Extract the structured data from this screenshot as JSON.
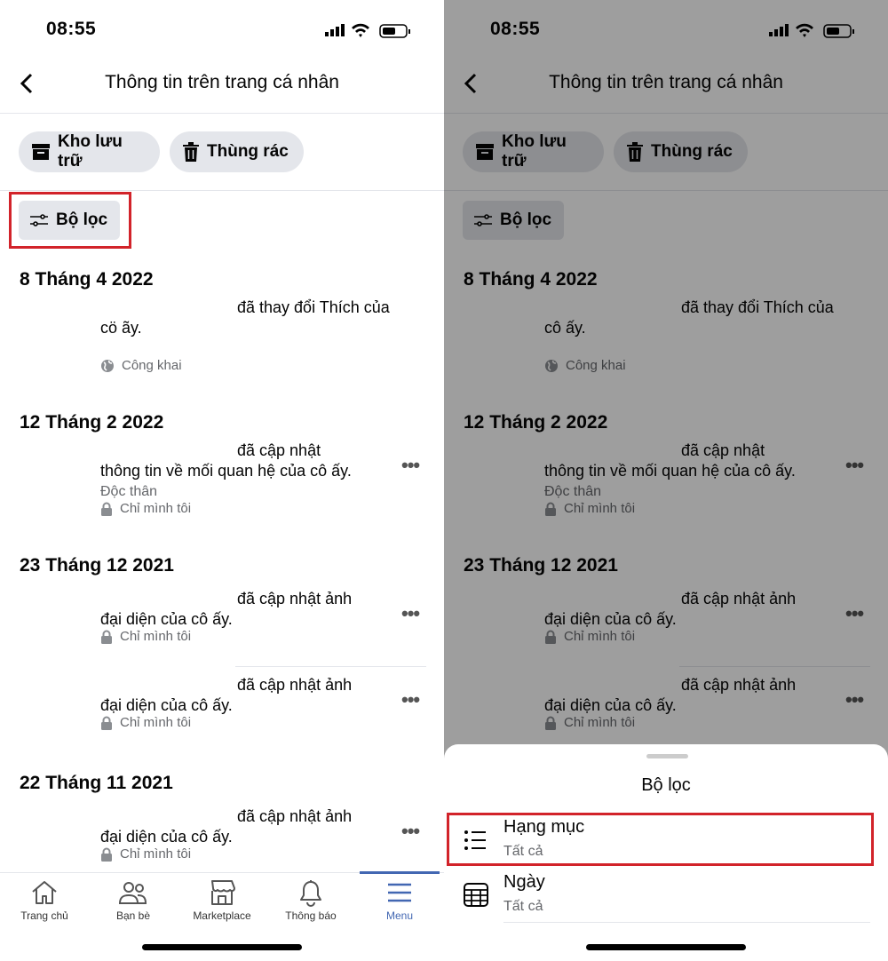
{
  "status_bar": {
    "time": "08:55"
  },
  "header": {
    "title": "Thông tin trên trang cá nhân",
    "back_icon": "chevron-left-icon"
  },
  "toolbar": {
    "archive_label": "Kho lưu trữ",
    "trash_label": "Thùng rác",
    "filter_label": "Bộ lọc"
  },
  "panels": [
    {
      "groups": [
        {
          "date": "8 Tháng 4 2022",
          "entries": [
            {
              "line1": "đã thay đổi Thích của",
              "line2": "cö ãy.",
              "privacy": "Công khai",
              "privacy_icon": "globe-icon",
              "more": false
            }
          ]
        },
        {
          "date": "12 Tháng 2 2022",
          "entries": [
            {
              "line1": "đã cập nhật",
              "line2": "thông tin về mối quan hệ của cô ấy.",
              "detail": "Độc thân",
              "privacy": "Chỉ mình tôi",
              "privacy_icon": "lock-icon",
              "more": true
            }
          ]
        },
        {
          "date": "23 Tháng 12 2021",
          "entries": [
            {
              "line1": "đã cập nhật ảnh",
              "line2": "đại diện của cô ấy.",
              "privacy": "Chỉ mình tôi",
              "privacy_icon": "lock-icon",
              "more": true
            },
            {
              "line1": "đã cập nhật ảnh",
              "line2": "đại diện của cô ấy.",
              "privacy": "Chỉ mình tôi",
              "privacy_icon": "lock-icon",
              "more": true
            }
          ]
        },
        {
          "date": "22 Tháng 11 2021",
          "entries": [
            {
              "line1": "đã cập nhật ảnh",
              "line2": "đại diện của cô ấy.",
              "privacy": "Chỉ mình tôi",
              "privacy_icon": "lock-icon",
              "more": true
            }
          ]
        }
      ]
    },
    {
      "groups": [
        {
          "date": "8 Tháng 4 2022",
          "entries": [
            {
              "line1": "đã thay đổi Thích của",
              "line2": "cô ấy.",
              "privacy": "Công khai",
              "privacy_icon": "globe-icon",
              "more": false
            }
          ]
        },
        {
          "date": "12 Tháng 2 2022",
          "entries": [
            {
              "line1": "đã cập nhật",
              "line2": "thông tin về mối quan hệ của cô ấy.",
              "detail": "Độc thân",
              "privacy": "Chỉ mình tôi",
              "privacy_icon": "lock-icon",
              "more": true
            }
          ]
        },
        {
          "date": "23 Tháng 12 2021",
          "entries": [
            {
              "line1": "đã cập nhật ảnh",
              "line2": "đại diện của cô ấy.",
              "privacy": "Chỉ mình tôi",
              "privacy_icon": "lock-icon",
              "more": true
            },
            {
              "line1": "đã cập nhật ảnh",
              "line2": "đại diện của cô ấy.",
              "privacy": "Chỉ mình tôi",
              "privacy_icon": "lock-icon",
              "more": true
            }
          ]
        }
      ]
    }
  ],
  "tabbar": {
    "active": "Menu",
    "active_color": "#1877f2",
    "items": [
      {
        "label": "Trang chủ",
        "icon": "home-icon"
      },
      {
        "label": "Bạn bè",
        "icon": "friends-icon"
      },
      {
        "label": "Marketplace",
        "icon": "marketplace-icon"
      },
      {
        "label": "Thông báo",
        "icon": "bell-icon"
      },
      {
        "label": "Menu",
        "icon": "menu-icon"
      }
    ]
  },
  "filter_sheet": {
    "title": "Bộ lọc",
    "options": [
      {
        "label": "Hạng mục",
        "value": "Tất cả",
        "icon": "list-icon"
      },
      {
        "label": "Ngày",
        "value": "Tất cả",
        "icon": "calendar-icon"
      }
    ]
  },
  "highlight_color": "#d2232a"
}
